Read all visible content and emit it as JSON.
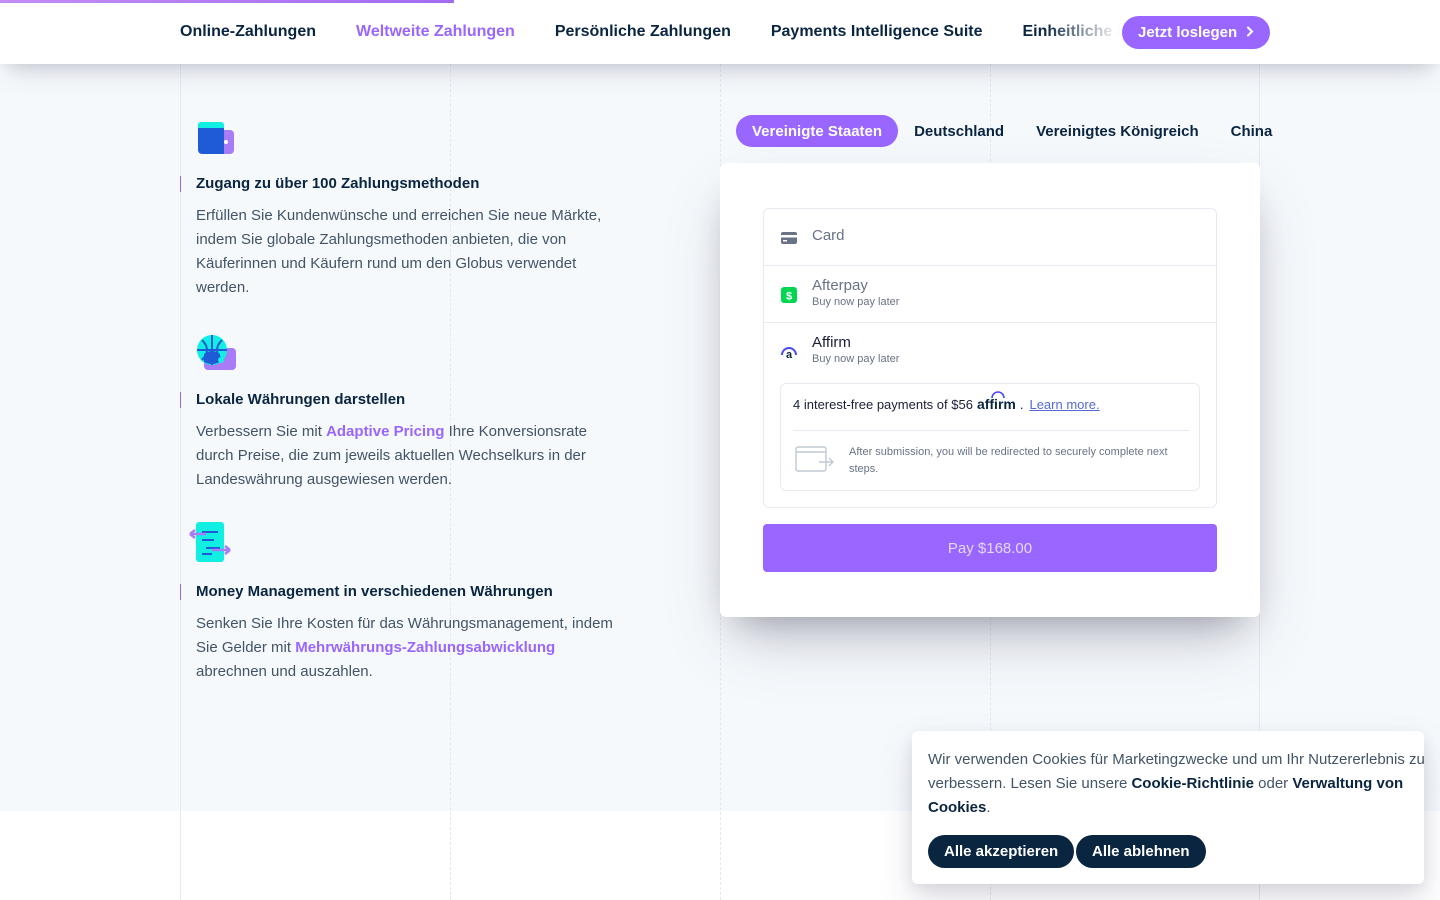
{
  "nav": {
    "items": [
      {
        "label": "Online-Zahlungen",
        "active": false
      },
      {
        "label": "Weltweite Zahlungen",
        "active": true
      },
      {
        "label": "Persönliche Zahlungen",
        "active": false
      },
      {
        "label": "Payments Intelligence Suite",
        "active": false
      },
      {
        "label": "Einheitliche Plattform",
        "active": false
      }
    ],
    "cta_label": "Jetzt loslegen",
    "cta_icon": "chevron-right-icon",
    "progress_fraction": 0.315
  },
  "features": [
    {
      "icon": "wallet-icon",
      "title": "Zugang zu über 100 Zahlungsmethoden",
      "description": "Erfüllen Sie Kundenwünsche und erreichen Sie neue Märkte, indem Sie globale Zahlungsmethoden anbieten, die von Käuferinnen und Käufern rund um den Globus verwendet werden."
    },
    {
      "icon": "globe-wallet-icon",
      "title": "Lokale Währungen darstellen",
      "description_before": "Verbessern Sie mit ",
      "link": "Adaptive Pricing",
      "description_after": " Ihre Konversionsrate durch Preise, die zum jeweils aktuellen Wechselkurs in der Landeswährung ausgewiesen werden."
    },
    {
      "icon": "currency-exchange-icon",
      "title": "Money Management in verschiedenen Währungen",
      "description_before": "Senken Sie Ihre Kosten für das Währungsmanagement, indem Sie Gelder mit ",
      "link": "Mehrwährungs-Zahlungsabwicklung",
      "description_after": " abrechnen und auszahlen."
    }
  ],
  "country_tabs": [
    {
      "label": "Vereinigte Staaten",
      "active": true
    },
    {
      "label": "Deutschland",
      "active": false
    },
    {
      "label": "Vereinigtes Königreich",
      "active": false
    },
    {
      "label": "China",
      "active": false
    }
  ],
  "payment": {
    "methods": [
      {
        "name": "Card",
        "subtitle": "",
        "icon": "credit-card-icon"
      },
      {
        "name": "Afterpay",
        "subtitle": "Buy now pay later",
        "icon": "afterpay-icon"
      },
      {
        "name": "Affirm",
        "subtitle": "Buy now pay later",
        "icon": "affirm-icon",
        "selected": true
      }
    ],
    "affirm_text": "4 interest-free payments of $56",
    "affirm_logo": "affirm",
    "affirm_learn_more": "Learn more.",
    "redirect_note": "After submission, you will be redirected to securely complete next steps.",
    "pay_label": "Pay $168.00"
  },
  "cookie": {
    "text_before": "Wir verwenden Cookies für Marketingzwecke und um Ihr Nutzererlebnis zu verbessern. Lesen Sie unsere ",
    "policy_link": "Cookie-Richtlinie",
    "text_middle": " oder ",
    "manage_link": "Verwaltung von Cookies",
    "text_after": ".",
    "accept_label": "Alle akzeptieren",
    "reject_label": "Alle ablehnen"
  },
  "colors": {
    "accent": "#9966ff",
    "dark": "#0a2540",
    "text": "#425466",
    "background": "#f6f9fc"
  }
}
